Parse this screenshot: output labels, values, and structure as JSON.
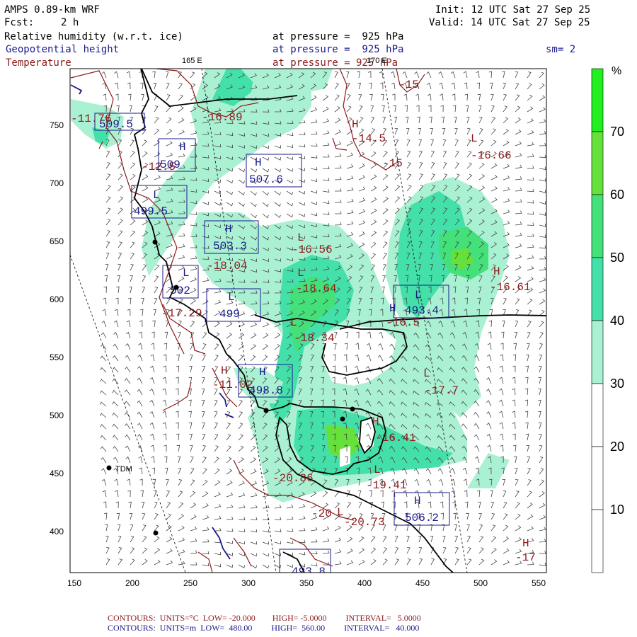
{
  "header": {
    "model": "AMPS 0.89-km WRF",
    "init": "Init: 12 UTC Sat 27 Sep 25",
    "fcst_label": "Fcst:",
    "fcst_value": "2 h",
    "valid": "Valid: 14 UTC Sat 27 Sep 25",
    "field1": "Relative humidity (w.r.t. ice)",
    "field1_level": "at pressure =  925 hPa",
    "field2": "Geopotential height",
    "field2_level": "at pressure =  925 hPa",
    "field3": "Temperature",
    "field3_level": "at pressure = 925 hPa",
    "smoothing": "sm= 2",
    "lon_165": "165 E",
    "lon_170": "170 E"
  },
  "colors": {
    "rh_ramp": [
      "#ffffff",
      "#ffffff",
      "#ffffff",
      "#aaf0d2",
      "#44e0aa",
      "#44e07a",
      "#66e03a",
      "#22ee22"
    ],
    "geo_contour": "#1a1a8c",
    "temp_contour": "#8b1a1a",
    "coast": "#000000"
  },
  "colorbar": {
    "unit": "%",
    "ticks": [
      "10",
      "20",
      "30",
      "40",
      "50",
      "60",
      "70"
    ]
  },
  "axes": {
    "x_ticks": [
      "150",
      "200",
      "250",
      "300",
      "350",
      "400",
      "450",
      "500",
      "550"
    ],
    "y_ticks": [
      "750",
      "700",
      "650",
      "600",
      "550",
      "500",
      "450",
      "400"
    ]
  },
  "stations": [
    {
      "name": "TDM"
    }
  ],
  "temperature_labels": [
    "-11.76",
    "-16.89",
    "-14.5",
    "-15",
    "-15",
    "-16.66",
    "-12.5",
    "-16.56",
    "-18.04",
    "-18.64",
    "-16.61",
    "-17.29",
    "-18.34",
    "-16.5",
    "-11.02",
    "-17.7",
    "-16.41",
    "-20.86",
    "-19.41",
    "-20",
    "-20.73",
    "-17"
  ],
  "height_labels": [
    "509.5",
    "509",
    "507.6",
    "499.5",
    "503.3",
    "502",
    "499",
    "493.4",
    "498.8",
    "506.2",
    "493.8"
  ],
  "pressure_marks": [
    "H",
    "L"
  ],
  "footer": {
    "line1": "CONTOURS:  UNITS=°C  LOW= -20.000        HIGH= -5.0000         INTERVAL=   5.0000",
    "line2": "CONTOURS:  UNITS=m  LOW=  480.00         HIGH=  560.00         INTERVAL=   40.000"
  }
}
